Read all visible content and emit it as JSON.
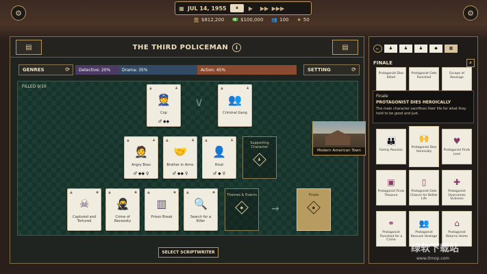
{
  "topbar": {
    "date": "JUL 14, 1955",
    "controls": [
      "⏸",
      "▶",
      "▶▶",
      "▶▶▶"
    ],
    "stats": {
      "money": "$812,200",
      "budget": "$100,000",
      "fans": "100",
      "stars": "50"
    }
  },
  "main": {
    "title": "THE THIRD POLICEMAN",
    "genres_label": "GENRES",
    "setting_label": "SETTING",
    "genres": [
      {
        "label": "Detective: 20%",
        "percent": 20,
        "color": "#4b3a63"
      },
      {
        "label": "Drama: 35%",
        "percent": 35,
        "color": "#334a64"
      },
      {
        "label": "Action: 45%",
        "percent": 45,
        "color": "#8a4a2f"
      }
    ],
    "filled": "FILLED 9/10",
    "cards": {
      "cop": "Cop",
      "criminal_gang": "Criminal Gang",
      "angry_boss": "Angry Boss",
      "brother_in_arms": "Brother in Arms",
      "rival": "Rival",
      "supporting_character": "Supporting Character",
      "captured": "Captured and Tortured",
      "crime_necessity": "Crime of Necessity",
      "prison_break": "Prison Break",
      "search_killer": "Search for a Killer",
      "themes_events": "Themes & Events",
      "finale": "Finale"
    },
    "setting": "Modern American Town",
    "select_scriptwriter": "SELECT SCRIPTWRITER"
  },
  "side": {
    "section_title": "FINALE",
    "tooltip": {
      "head": "Finale",
      "name": "PROTAGONIST DIES HEROICALLY",
      "desc": "The main character sacrifices their life for what they hold to be good and just."
    },
    "cards": [
      "Protagonist Dies Killed",
      "Protagonist Gets Punished",
      "Escape of Revenge",
      "Family Reunion",
      "Protagonist Dies Heroically",
      "Protagonist Finds Love",
      "Protagonist Finds Treasure",
      "Protagonist Gets Chance for Better Life",
      "Protagonist Overcomes Sickness",
      "Protagonist Punished for a Crime",
      "Protagonist Rescues Hostage",
      "Protagonist Returns Home"
    ]
  },
  "watermark": {
    "text": "绿软下载站",
    "url": "www.itmop.com"
  }
}
